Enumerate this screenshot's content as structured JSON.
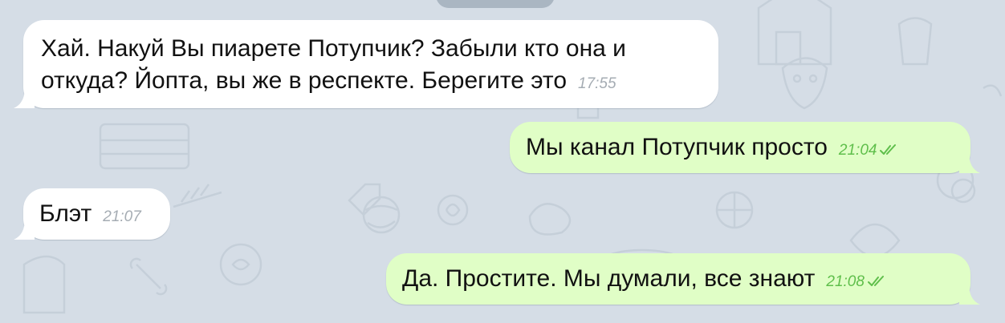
{
  "colors": {
    "background": "#d5dde6",
    "incoming_bubble": "#ffffff",
    "outgoing_bubble": "#e0fec6",
    "incoming_time": "#a5acb3",
    "outgoing_time": "#5fbf4b"
  },
  "messages": [
    {
      "direction": "incoming",
      "line1": "Хай. Накуй Вы пиарете Потупчик? Забыли кто она и",
      "line2": "откуда? Йопта, вы же в респекте. Берегите это",
      "time": "17:55"
    },
    {
      "direction": "outgoing",
      "text": "Мы канал Потупчик просто",
      "time": "21:04",
      "status_icon": "double-check-icon"
    },
    {
      "direction": "incoming",
      "text": "Блэт",
      "time": "21:07"
    },
    {
      "direction": "outgoing",
      "text": "Да. Простите. Мы думали, все знают",
      "time": "21:08",
      "status_icon": "double-check-icon"
    }
  ]
}
